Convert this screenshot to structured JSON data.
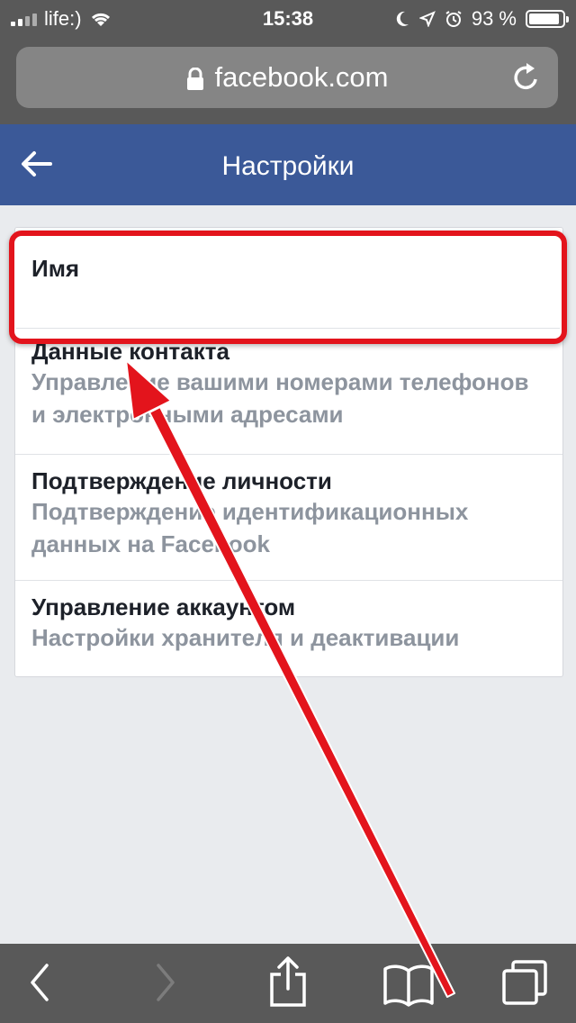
{
  "status_bar": {
    "carrier": "life:)",
    "time": "15:38",
    "battery_percent": "93 %",
    "battery_level": 0.93
  },
  "browser": {
    "url": "facebook.com",
    "icons": {
      "lock": "lock-icon",
      "reload": "reload-icon",
      "back": "chevron-left-icon",
      "forward": "chevron-right-icon",
      "share": "share-icon",
      "bookmarks": "book-icon",
      "tabs": "tabs-icon"
    }
  },
  "header": {
    "title": "Настройки",
    "back_icon": "arrow-left-icon"
  },
  "settings": {
    "items": [
      {
        "label": "Имя",
        "desc": ""
      },
      {
        "label": "Данные контакта",
        "desc": "Управление вашими номерами телефонов и электронными адресами"
      },
      {
        "label": "Подтверждение личности",
        "desc": "Подтверждение идентификационных данных на Facebook"
      },
      {
        "label": "Управление аккаунтом",
        "desc": "Настройки хранителя и деактивации"
      }
    ]
  },
  "colors": {
    "facebook_blue": "#3b5998",
    "browser_chrome": "#595959",
    "page_background": "#e9ebee",
    "annotation_red": "#e3141c"
  }
}
